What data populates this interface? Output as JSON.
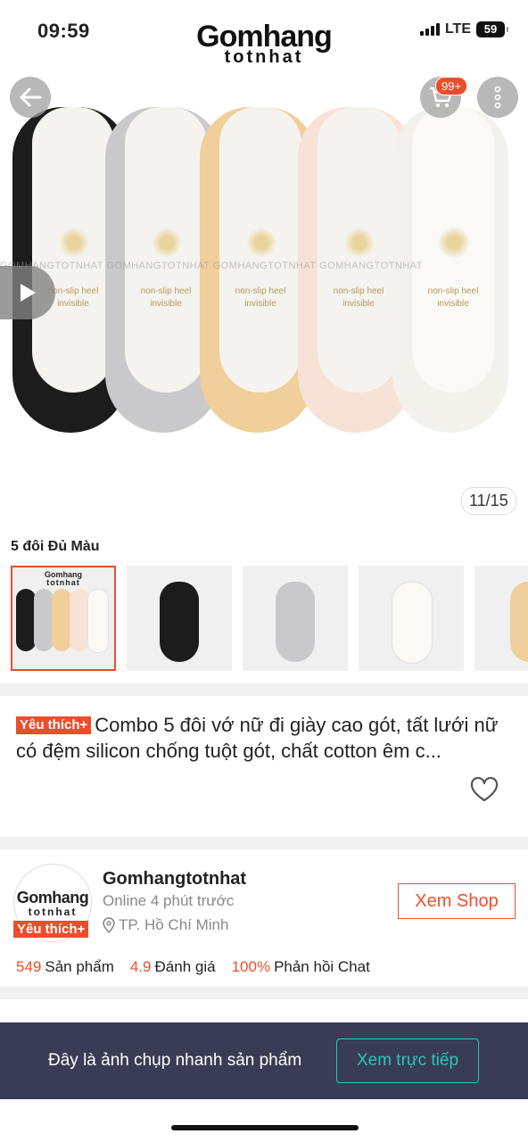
{
  "status": {
    "time": "09:59",
    "network": "LTE",
    "battery": "59"
  },
  "header": {
    "logo_main": "Gomhang",
    "logo_sub": "totnhat",
    "cart_badge": "99+"
  },
  "gallery": {
    "watermark": "GOMHANGTOTNHAT  GOMHANGTOTNHAT  GOMHANGTOTNHAT  GOMHANGTOTNHAT",
    "sock_text_1": "non-slip heel",
    "sock_text_2": "invisible",
    "counter": "11/15"
  },
  "variant": {
    "label": "5 đôi Đủ Màu",
    "thumb_logo_main": "Gomhang",
    "thumb_logo_sub": "totnhat"
  },
  "product": {
    "tag": "Yêu thích+",
    "title": "Combo 5 đôi vớ nữ đi giày cao gót, tất lưới nữ có đệm silicon chống tuột gót, chất cotton êm c..."
  },
  "shop": {
    "avatar_main": "Gomhang",
    "avatar_sub": "totnhat",
    "tag": "Yêu thích+",
    "name": "Gomhangtotnhat",
    "online": "Online 4 phút trước",
    "location": "TP. Hồ Chí Minh",
    "view_button": "Xem Shop",
    "products_value": "549",
    "products_label": "Sản phẩm",
    "rating_value": "4.9",
    "rating_label": "Đánh giá",
    "chat_value": "100%",
    "chat_label": "Phản hồi Chat"
  },
  "banner": {
    "text": "Đây là ảnh chụp nhanh sản phẩm",
    "button": "Xem trực tiếp"
  },
  "colors": {
    "accent": "#ee4d2d",
    "banner_bg": "#383c55",
    "teal": "#2ec4b6"
  }
}
